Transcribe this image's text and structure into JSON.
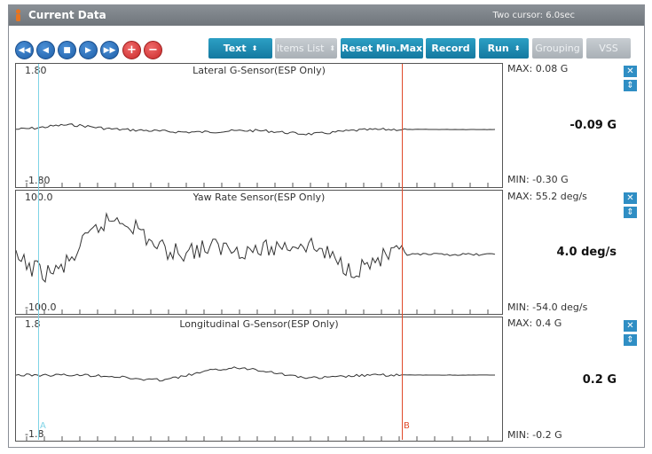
{
  "window": {
    "title": "Current Data",
    "cursor_info": "Two cursor: 6.0sec"
  },
  "toolbar": {
    "text_select": "Text",
    "items_list": "Items List",
    "reset_minmax": "Reset Min.Max",
    "record": "Record",
    "run": "Run",
    "grouping": "Grouping",
    "vss": "VSS",
    "plus": "+",
    "minus": "−"
  },
  "colors": {
    "cursor_a": "#7fd3e6",
    "cursor_b": "#e04a2a",
    "accent": "#1f87b8"
  },
  "cursors": {
    "a_label": "A",
    "b_label": "B"
  },
  "panels": [
    {
      "title": "Lateral G-Sensor(ESP Only)",
      "y_max": "1.80",
      "y_min": "-1.80",
      "max": "MAX:  0.08 G",
      "min": "MIN: -0.30 G",
      "current": "-0.09 G"
    },
    {
      "title": "Yaw Rate Sensor(ESP Only)",
      "y_max": "100.0",
      "y_min": "-100.0",
      "max": "MAX:  55.2 deg/s",
      "min": "MIN: -54.0 deg/s",
      "current": "4.0 deg/s"
    },
    {
      "title": "Longitudinal G-Sensor(ESP Only)",
      "y_max": "1.8",
      "y_min": "-1.8",
      "max": "MAX:  0.4 G",
      "min": "MIN: -0.2 G",
      "current": "0.2 G"
    }
  ],
  "icons": [
    "person-icon",
    "rewind-icon",
    "step-back-icon",
    "stop-icon",
    "play-icon",
    "fast-forward-icon",
    "add-icon",
    "remove-icon",
    "close-icon",
    "expand-icon"
  ]
}
